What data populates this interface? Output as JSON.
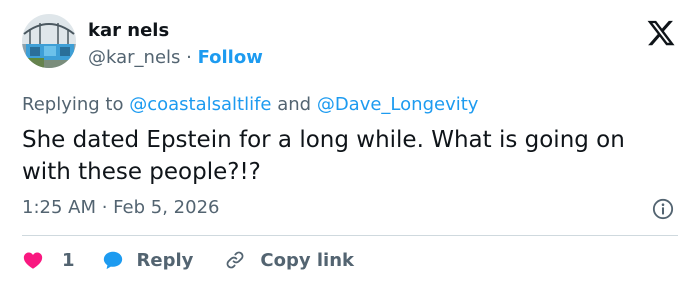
{
  "author": {
    "name": "kar nels",
    "handle": "@kar_nels",
    "separator": " · ",
    "follow_label": "Follow",
    "avatar_icon": "bridge-graffiti-avatar"
  },
  "brand": {
    "logo_icon": "x-logo-icon",
    "color": "#0f1419"
  },
  "replying": {
    "prefix": "Replying to ",
    "mention_1": "@coastalsaltlife",
    "conjunction": " and ",
    "mention_2": "@Dave_Longevity"
  },
  "tweet": {
    "text": "She dated Epstein for a long while. What is going on with these people?!?"
  },
  "meta": {
    "time": "1:25 AM",
    "separator": " · ",
    "date": "Feb 5, 2026",
    "info_icon": "info-icon"
  },
  "actions": {
    "like_count": "1",
    "reply_label": "Reply",
    "copy_link_label": "Copy link",
    "like_color": "#f91880",
    "reply_icon_color": "#1d9bf0"
  },
  "colors": {
    "text_primary": "#0f1419",
    "text_secondary": "#536471",
    "accent": "#1d9bf0",
    "divider": "#cfd9de"
  }
}
